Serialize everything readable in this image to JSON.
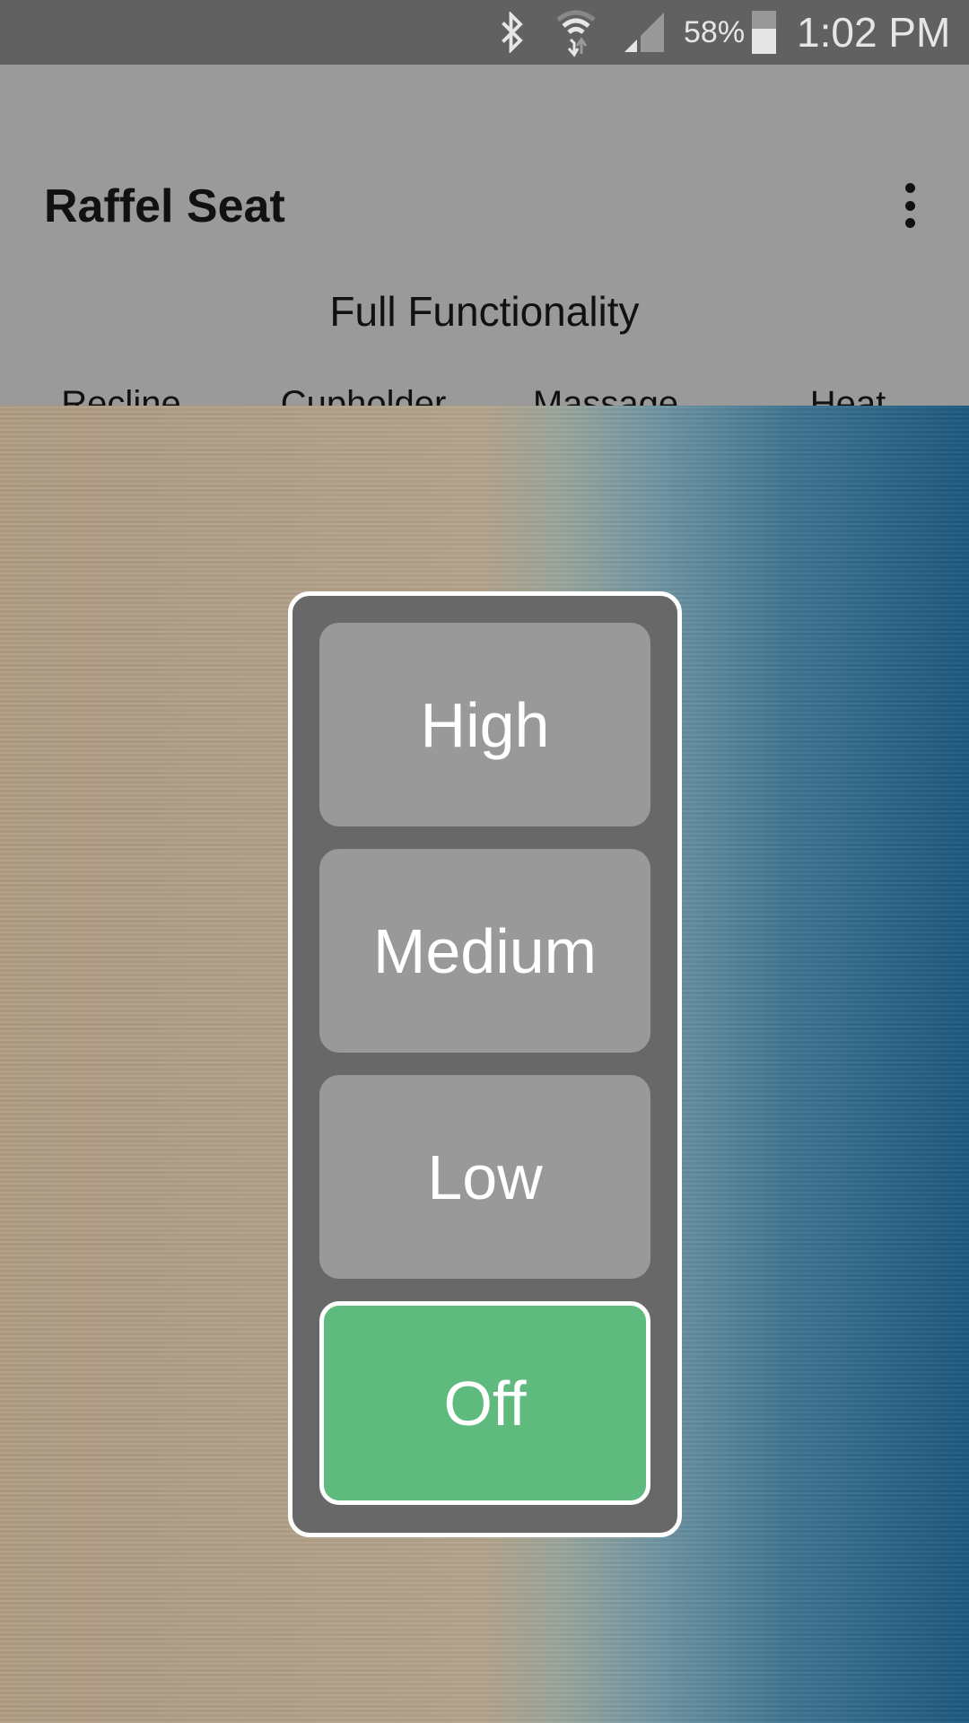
{
  "status_bar": {
    "battery": "58%",
    "time": "1:02 PM",
    "icons": [
      "bluetooth-icon",
      "wifi-icon",
      "signal-icon",
      "battery-icon"
    ],
    "battery_level": 0.58
  },
  "app_bar": {
    "title": "Raffel Seat",
    "subtitle": "Full Functionality",
    "menu_icon": "more-vert-icon"
  },
  "tabs": [
    {
      "label": "Recline"
    },
    {
      "label": "Cupholder"
    },
    {
      "label": "Massage"
    },
    {
      "label": "Heat",
      "selected": true
    }
  ],
  "heat": {
    "options": [
      {
        "label": "High"
      },
      {
        "label": "Medium"
      },
      {
        "label": "Low"
      },
      {
        "label": "Off",
        "selected": true
      }
    ]
  },
  "colors": {
    "accent": "#5fba7d",
    "app_bar": "#9a9a9a",
    "status_bar": "#616161",
    "panel": "#686868",
    "button": "#999999"
  }
}
